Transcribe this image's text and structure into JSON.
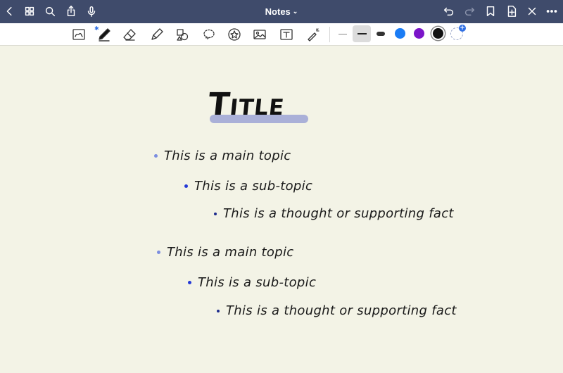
{
  "top_bar": {
    "title": "Notes",
    "left_icons": [
      "back-icon",
      "thumbnails-icon",
      "search-icon",
      "share-icon",
      "microphone-icon"
    ],
    "right_icons": [
      "undo-icon",
      "redo-icon",
      "bookmark-icon",
      "add-page-icon",
      "close-icon",
      "more-icon"
    ]
  },
  "toolbar": {
    "tools": [
      "lasso-image-icon",
      "pen-icon",
      "eraser-icon",
      "highlighter-icon",
      "shapes-icon",
      "lasso-icon",
      "sticker-icon",
      "image-icon",
      "text-box-icon",
      "laser-pointer-icon"
    ],
    "stroke_widths": [
      "thin",
      "medium",
      "thick"
    ],
    "selected_width": "medium",
    "colors": [
      "#1a7cf5",
      "#7b14c9",
      "#111111"
    ],
    "selected_color": "#111111"
  },
  "note": {
    "title": "Title",
    "highlight_color": "#aab0d8",
    "outline": [
      {
        "level": 1,
        "text": "This is a main topic"
      },
      {
        "level": 2,
        "text": "This is a sub-topic"
      },
      {
        "level": 3,
        "text": "This is a thought or supporting fact"
      },
      {
        "level": 1,
        "text": "This is a main topic"
      },
      {
        "level": 2,
        "text": "This is a sub-topic"
      },
      {
        "level": 3,
        "text": "This is a thought or supporting fact"
      }
    ]
  }
}
